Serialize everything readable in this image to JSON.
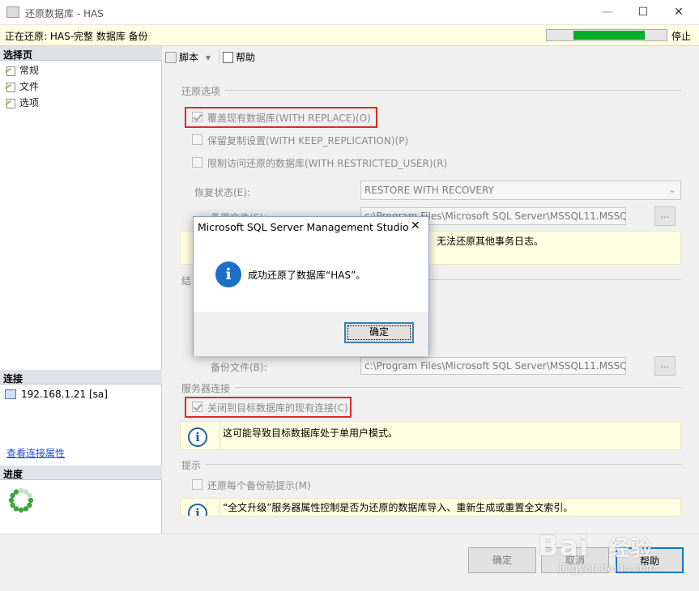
{
  "window": {
    "title": "还原数据库 - HAS",
    "min_symbol": "—",
    "max_symbol": "☐",
    "close_symbol": "✕"
  },
  "status": {
    "text": "正在还原: HAS-完整 数据库 备份",
    "progress_percent": 77,
    "stop_label": "停止"
  },
  "sidebar": {
    "select_page_header": "选择页",
    "pages": [
      "常规",
      "文件",
      "选项"
    ],
    "connection_header": "连接",
    "server": "192.168.1.21 [sa]",
    "view_connection_link": "查看连接属性",
    "progress_header": "进度"
  },
  "toolbar": {
    "script_label": "脚本",
    "script_dropdown": "▾",
    "help_label": "帮助"
  },
  "restore_options": {
    "group_label": "还原选项",
    "overwrite": {
      "label": "覆盖现有数据库(WITH REPLACE)(O)",
      "checked": true
    },
    "keep_replication": {
      "label": "保留复制设置(WITH KEEP_REPLICATION)(P)",
      "checked": false
    },
    "restricted_user": {
      "label": "限制访问还原的数据库(WITH RESTRICTED_USER)(R)",
      "checked": false
    },
    "recovery_state_label": "恢复状态(E):",
    "recovery_state_value": "RESTORE WITH RECOVERY",
    "standby_file_label": "备用文件(S):",
    "standby_file_value": "c:\\Program Files\\Microsoft SQL Server\\MSSQL11.MSSQ",
    "browse_label": "...",
    "info_text": "无法还原其他事务日志。",
    "group_prefix": "结"
  },
  "tail_log": {
    "backup_file_label": "备份文件(B):",
    "backup_file_value": "c:\\Program Files\\Microsoft SQL Server\\MSSQL11.MSSQ",
    "browse_label": "..."
  },
  "server_connections": {
    "group_label": "服务器连接",
    "close_connections": {
      "label": "关闭到目标数据库的现有连接(C)",
      "checked": true
    },
    "info_text": "这可能导致目标数据库处于单用户模式。"
  },
  "prompt": {
    "group_label": "提示",
    "prompt_before_backup": {
      "label": "还原每个备份前提示(M)",
      "checked": false
    },
    "info_text": "“全文升级”服务器属性控制是否为还原的数据库导入、重新生成或重置全文索引。"
  },
  "buttons": {
    "ok": "确定",
    "cancel": "取消",
    "help": "帮助"
  },
  "dialog": {
    "title": "Microsoft SQL Server Management Studio",
    "close_symbol": "✕",
    "message": "成功还原了数据库“HAS”。",
    "ok_label": "确定",
    "icon_glyph": "i"
  },
  "info_icon_glyph": "i",
  "watermark": {
    "text1": "Bai",
    "text2": "经验",
    "url": "jingyan.baidu.com"
  },
  "colors": {
    "accent": "#1a6fc9",
    "progress_fill": "#06b025",
    "highlight_box": "#e22828",
    "info_bg": "#ffffe1"
  }
}
